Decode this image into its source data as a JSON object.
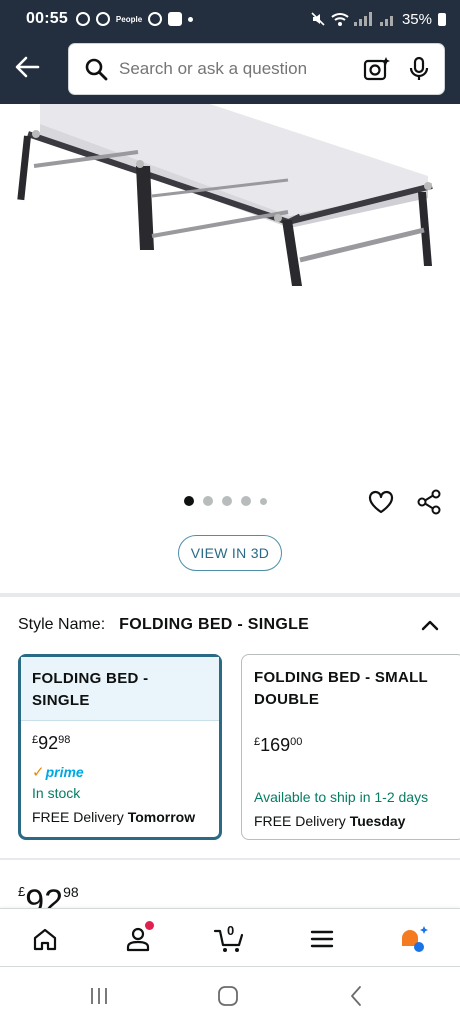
{
  "status_bar": {
    "time": "00:55",
    "notification_icons": [
      "chrome-icon",
      "chrome-icon",
      "people-icon",
      "chrome-icon",
      "checkbox-icon"
    ],
    "people_label": "People",
    "battery": "35%"
  },
  "header": {
    "search_placeholder": "Search or ask a question",
    "background_color": "#232f3e"
  },
  "gallery": {
    "image_count": 5,
    "active_index": 0
  },
  "view_3d_label": "VIEW IN 3D",
  "style_selector": {
    "label": "Style Name:",
    "value": "FOLDING BED - SINGLE",
    "options": [
      {
        "name": "FOLDING BED - SINGLE",
        "price_symbol": "£",
        "price_whole": "92",
        "price_fraction": "98",
        "prime": "prime",
        "availability": "In stock",
        "delivery_prefix": "FREE Delivery",
        "delivery_day": "Tomorrow",
        "selected": true
      },
      {
        "name": "FOLDING BED - SMALL DOUBLE",
        "price_symbol": "£",
        "price_whole": "169",
        "price_fraction": "00",
        "availability": "Available to ship in 1-2 days",
        "delivery_prefix": "FREE Delivery",
        "delivery_day": "Tuesday",
        "selected": false
      }
    ]
  },
  "main_price": {
    "symbol": "£",
    "whole": "92",
    "fraction": "98"
  },
  "bottom_nav": {
    "items": [
      "home-icon",
      "account-icon",
      "cart-icon",
      "menu-icon",
      "rufus-icon"
    ],
    "cart_count": "0",
    "accent_color": "#2a6a85"
  }
}
